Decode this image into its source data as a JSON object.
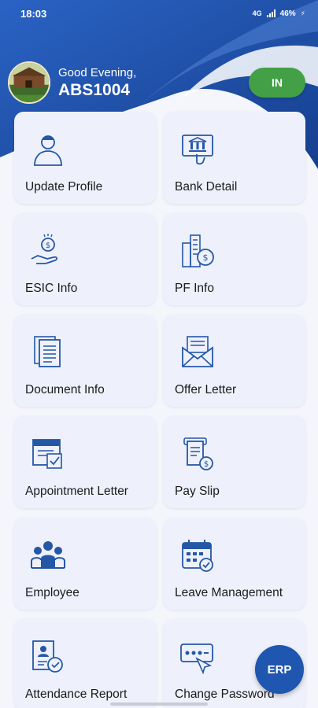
{
  "status_bar": {
    "time": "18:03",
    "network": "4G",
    "battery": "46%"
  },
  "header": {
    "greeting": "Good Evening,",
    "user_id": "ABS1004",
    "in_button": "IN"
  },
  "menu": [
    {
      "label": "Update Profile",
      "icon": "user-profile-icon"
    },
    {
      "label": "Bank Detail",
      "icon": "bank-icon"
    },
    {
      "label": "ESIC Info",
      "icon": "money-hand-icon"
    },
    {
      "label": "PF Info",
      "icon": "city-money-icon"
    },
    {
      "label": "Document Info",
      "icon": "document-icon"
    },
    {
      "label": "Offer Letter",
      "icon": "envelope-letter-icon"
    },
    {
      "label": "Appointment Letter",
      "icon": "appointment-letter-icon"
    },
    {
      "label": "Pay Slip",
      "icon": "pay-slip-icon"
    },
    {
      "label": "Employee",
      "icon": "team-icon"
    },
    {
      "label": "Leave Management",
      "icon": "calendar-check-icon"
    },
    {
      "label": "Attendance Report",
      "icon": "attendance-report-icon"
    },
    {
      "label": "Change Password",
      "icon": "password-icon"
    }
  ],
  "fab": {
    "label": "ERP"
  },
  "colors": {
    "header_blue": "#1f4fa8",
    "accent_green": "#43a047",
    "icon_blue": "#2557a7",
    "card_bg": "#eef1fb"
  }
}
